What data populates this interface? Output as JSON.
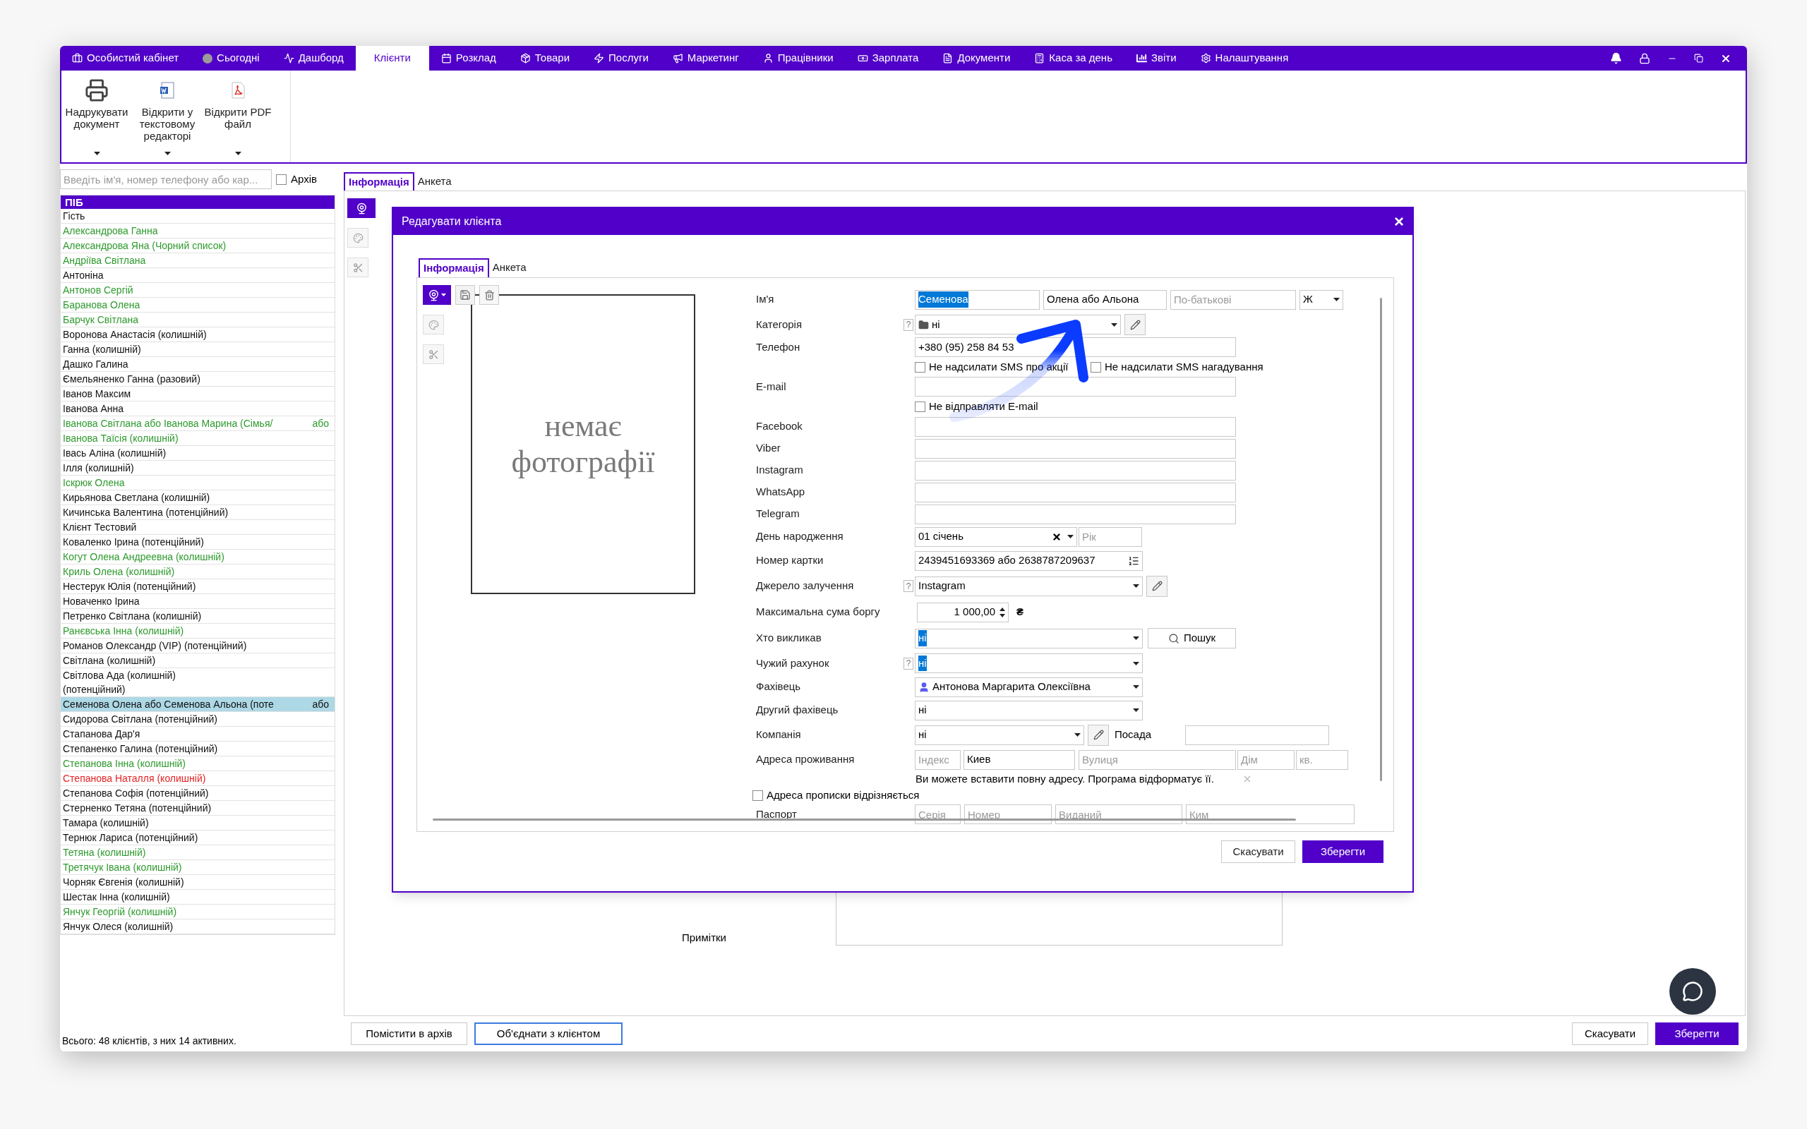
{
  "nav": [
    {
      "label": "Особистий кабінет",
      "selected": false
    },
    {
      "label": "Сьогодні",
      "selected": false
    },
    {
      "label": "Дашборд",
      "selected": false
    },
    {
      "label": "Клієнти",
      "selected": true
    },
    {
      "label": "Розклад",
      "selected": false
    },
    {
      "label": "Товари",
      "selected": false
    },
    {
      "label": "Послуги",
      "selected": false
    },
    {
      "label": "Маркетинг",
      "selected": false
    },
    {
      "label": "Працівники",
      "selected": false
    },
    {
      "label": "Зарплата",
      "selected": false
    },
    {
      "label": "Документи",
      "selected": false
    },
    {
      "label": "Каса за день",
      "selected": false
    },
    {
      "label": "Звіти",
      "selected": false
    },
    {
      "label": "Налаштування",
      "selected": false
    }
  ],
  "ribbon": [
    {
      "label": "Надрукувати документ"
    },
    {
      "label": "Відкрити у текстовому редакторі"
    },
    {
      "label": "Відкрити PDF файл"
    }
  ],
  "search": {
    "placeholder": "Введіть ім'я, номер телефону або кар..."
  },
  "archive": {
    "label": "Архів",
    "checked": false
  },
  "client_list": {
    "header": "ПІБ",
    "rows": [
      {
        "name": "Гість",
        "color": "#111111",
        "selected": false
      },
      {
        "name": "Александрова Ганна",
        "color": "#2e9a2e",
        "selected": false
      },
      {
        "name": "Александрова Яна (Чорний список)",
        "color": "#2e9a2e",
        "selected": false
      },
      {
        "name": "Андріїва Світлана",
        "color": "#2e9a2e",
        "selected": false
      },
      {
        "name": "Антоніна",
        "color": "#111111",
        "selected": false
      },
      {
        "name": "Антонов Сергій",
        "color": "#2e9a2e",
        "selected": false
      },
      {
        "name": "Баранова Олена",
        "color": "#2e9a2e",
        "selected": false
      },
      {
        "name": "Барчук Світлана",
        "color": "#2e9a2e",
        "selected": false
      },
      {
        "name": "Воронова Анастасія (колишній)",
        "color": "#111111",
        "selected": false
      },
      {
        "name": "Ганна (колишній)",
        "color": "#111111",
        "selected": false
      },
      {
        "name": "Дашко Галина",
        "color": "#111111",
        "selected": false
      },
      {
        "name": "Ємельяненко Ганна (разовий)",
        "color": "#111111",
        "selected": false
      },
      {
        "name": "Іванов Максим",
        "color": "#111111",
        "selected": false
      },
      {
        "name": "Іванова Анна",
        "color": "#111111",
        "selected": false
      },
      {
        "name": "Іванова Світлана  або Іванова  Марина (Сімья/",
        "extra": "або",
        "color": "#2e9a2e",
        "selected": false
      },
      {
        "name": "Іванова Таїсія (колишній)",
        "color": "#2e9a2e",
        "selected": false
      },
      {
        "name": "Івась Аліна (колишній)",
        "color": "#111111",
        "selected": false
      },
      {
        "name": "Ілля (колишній)",
        "color": "#111111",
        "selected": false
      },
      {
        "name": "Іскрюк Олена",
        "color": "#2e9a2e",
        "selected": false
      },
      {
        "name": "Кирьянова Светлана (колишній)",
        "color": "#111111",
        "selected": false
      },
      {
        "name": "Кичинська Валентина (потенційний)",
        "color": "#111111",
        "selected": false
      },
      {
        "name": "Клієнт Тестовий",
        "color": "#111111",
        "selected": false
      },
      {
        "name": "Коваленко Ірина (потенційний)",
        "color": "#111111",
        "selected": false
      },
      {
        "name": "Когут Олена Андреевна (колишній)",
        "color": "#2e9a2e",
        "selected": false
      },
      {
        "name": "Криль Олена (колишній)",
        "color": "#2e9a2e",
        "selected": false
      },
      {
        "name": "Нестерук Юлія (потенційний)",
        "color": "#111111",
        "selected": false
      },
      {
        "name": "Новаченко Ірина",
        "color": "#111111",
        "selected": false
      },
      {
        "name": "Петренко Світлана (колишній)",
        "color": "#111111",
        "selected": false
      },
      {
        "name": "Ранєвська Інна (колишній)",
        "color": "#2e9a2e",
        "selected": false
      },
      {
        "name": "Романов Олександр (VIP) (потенційний)",
        "color": "#111111",
        "selected": false
      },
      {
        "name": "Світлана (колишній)",
        "color": "#111111",
        "selected": false
      },
      {
        "name": "Світлова Ада (колишній)\n (потенційний)",
        "color": "#111111",
        "selected": false
      },
      {
        "name": "Семенова Олена або Семенова Альона (поте",
        "extra": "або",
        "color": "#111111",
        "selected": true
      },
      {
        "name": "Сидорова Світлана (потенційний)",
        "color": "#111111",
        "selected": false
      },
      {
        "name": "Стапанова Дар'я",
        "color": "#111111",
        "selected": false
      },
      {
        "name": "Степаненко Галина (потенційний)",
        "color": "#111111",
        "selected": false
      },
      {
        "name": "Степанова Інна (колишній)",
        "color": "#2e9a2e",
        "selected": false
      },
      {
        "name": "Степанова Наталля (колишній)",
        "color": "#e52222",
        "selected": false
      },
      {
        "name": "Степанова Софія (потенційний)",
        "color": "#111111",
        "selected": false
      },
      {
        "name": "Стерненко Тетяна (потенційний)",
        "color": "#111111",
        "selected": false
      },
      {
        "name": "Тамара (колишній)",
        "color": "#111111",
        "selected": false
      },
      {
        "name": "Тернюк Лариса (потенційний)",
        "color": "#111111",
        "selected": false
      },
      {
        "name": "Тетяна (колишній)",
        "color": "#2e9a2e",
        "selected": false
      },
      {
        "name": "Третячук Івана (колишній)",
        "color": "#2e9a2e",
        "selected": false
      },
      {
        "name": "Чорняк Євгенія (колишній)",
        "color": "#111111",
        "selected": false
      },
      {
        "name": "Шестак Інна (колишній)",
        "color": "#111111",
        "selected": false
      },
      {
        "name": "Янчук Георгій (колишній)",
        "color": "#2e9a2e",
        "selected": false
      },
      {
        "name": "Янчук Олеся (колишній)",
        "color": "#111111",
        "selected": false
      }
    ]
  },
  "list_footer": "Всього: 48 клієнтів, з них 14 активних.",
  "main_tabs": [
    {
      "label": "Інформація",
      "selected": true
    },
    {
      "label": "Анкета",
      "selected": false
    }
  ],
  "notes_label": "Примітки",
  "bottom_left_buttons": [
    {
      "label": "Помістити в архів",
      "focused": false
    },
    {
      "label": "Об'єднати з клієнтом",
      "focused": true
    }
  ],
  "bottom_right_buttons": [
    {
      "label": "Скасувати",
      "primary": false
    },
    {
      "label": "Зберегти",
      "primary": true
    }
  ],
  "dialog": {
    "title": "Редагувати клієнта",
    "close": "×",
    "tabs": [
      {
        "label": "Інформація",
        "selected": true
      },
      {
        "label": "Анкета",
        "selected": false
      }
    ],
    "photo_text": [
      "немає",
      "фотографії"
    ],
    "name": {
      "label": "Ім'я",
      "surname": "Семенова",
      "surname_highlighted": true,
      "first_name": "Олена або Альона",
      "patronymic_placeholder": "По-батькові",
      "gender": "Ж"
    },
    "category": {
      "label": "Категорія",
      "help": "?",
      "value": "ні"
    },
    "phone": {
      "label": "Телефон",
      "value": "+380 (95) 258 84 53"
    },
    "sms_options": [
      {
        "label": "Не надсилати SMS про акції",
        "checked": false
      },
      {
        "label": "Не надсилати SMS нагадування",
        "checked": false
      }
    ],
    "email": {
      "label": "E-mail"
    },
    "email_option": {
      "label": "Не відправляти E-mail",
      "checked": false
    },
    "socials": [
      {
        "label": "Facebook"
      },
      {
        "label": "Viber"
      },
      {
        "label": "Instagram"
      },
      {
        "label": "WhatsApp"
      },
      {
        "label": "Telegram"
      }
    ],
    "birthday": {
      "label": "День народження",
      "value": "01 січень",
      "year_placeholder": "Рік"
    },
    "card": {
      "label": "Номер картки",
      "value": "2439451693369 або 2638787209637"
    },
    "source": {
      "label": "Джерело залучення",
      "help": "?",
      "value": "Instagram"
    },
    "debt": {
      "label": "Максимальна сума боргу",
      "value": "1 000,00",
      "currency": "₴"
    },
    "who_called": {
      "label": "Хто викликав",
      "value": "ні",
      "highlighted": true,
      "button": "Пошук"
    },
    "foreign_account": {
      "label": "Чужий рахунок",
      "help": "?",
      "value": "ні",
      "highlighted": true
    },
    "specialist": {
      "label": "Фахівець",
      "value": "Антонова Маргарита Олексіївна"
    },
    "second_specialist": {
      "label": "Другий фахівець",
      "value": "ні"
    },
    "company": {
      "label": "Компанія",
      "value": "ні",
      "position_label": "Посада"
    },
    "address": {
      "label": "Адреса проживання",
      "index_placeholder": "Індекс",
      "city": "Киев",
      "street_placeholder": "Вулиця",
      "house_placeholder": "Дім",
      "apartment_placeholder": "кв.",
      "hint": "Ви можете вставити повну адресу. Програма відформатує її."
    },
    "registration_differs": {
      "label": "Адреса прописки відрізняється",
      "checked": false
    },
    "passport": {
      "label": "Паспорт",
      "placeholders": [
        "Серія",
        "Номер",
        "Виданий",
        "Ким"
      ]
    },
    "buttons": [
      {
        "label": "Скасувати",
        "primary": false
      },
      {
        "label": "Зберегти",
        "primary": true
      }
    ]
  }
}
